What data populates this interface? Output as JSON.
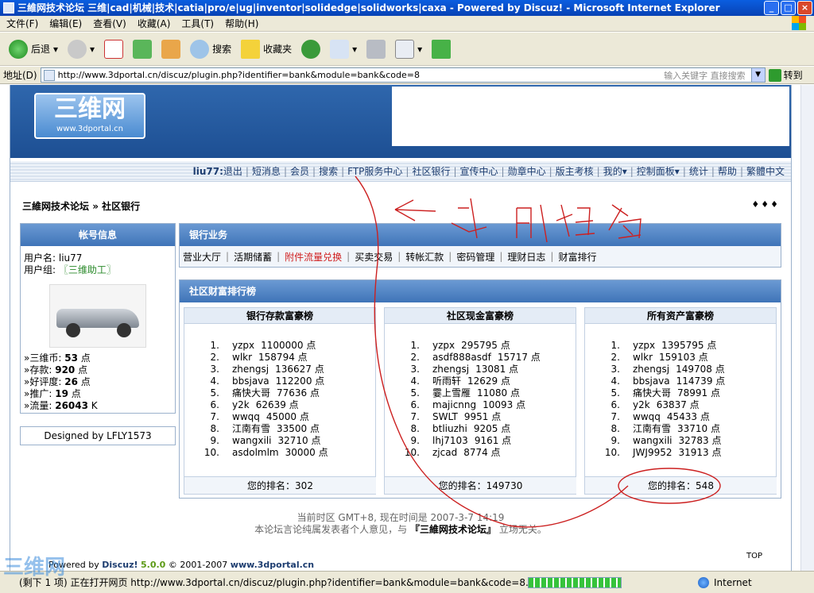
{
  "window": {
    "title": "三維网技术论坛 三维|cad|机械|技术|catia|pro/e|ug|inventor|solidedge|solidworks|caxa - Powered by Discuz! - Microsoft Internet Explorer",
    "controls": [
      "_",
      "□",
      "×"
    ]
  },
  "menu": [
    "文件(F)",
    "编辑(E)",
    "查看(V)",
    "收藏(A)",
    "工具(T)",
    "帮助(H)"
  ],
  "toolbar": {
    "back": "后退",
    "search": "搜索",
    "favorites": "收藏夹"
  },
  "address": {
    "label": "地址(D)",
    "url": "http://www.3dportal.cn/discuz/plugin.php?identifier=bank&module=bank&code=8",
    "hint": "输入关键字 直接搜索",
    "go": "转到"
  },
  "logo": {
    "big": "三维网",
    "small": "www.3dportal.cn"
  },
  "nav": {
    "user": "liu77:",
    "items": [
      "退出",
      "短消息",
      "会员",
      "搜索",
      "FTP服务中心",
      "社区银行",
      "宣传中心",
      "勋章中心",
      "版主考核",
      "我的▾",
      "控制面板▾",
      "统计",
      "帮助",
      "繁體中文"
    ]
  },
  "breadcrumb": {
    "forum": "三維网技术论坛",
    "sep": "»",
    "page": "社区银行"
  },
  "more": "♦♦♦",
  "account": {
    "title": "帐号信息",
    "username_label": "用户名:",
    "username": "liu77",
    "group_label": "用户组:",
    "group": "〖三维助工〗",
    "stats": [
      {
        "label": "»三维币:",
        "value": "53",
        "unit": "点"
      },
      {
        "label": "»存款:",
        "value": "920",
        "unit": "点"
      },
      {
        "label": "»好评度:",
        "value": "26",
        "unit": "点"
      },
      {
        "label": "»推广:",
        "value": "19",
        "unit": "点"
      },
      {
        "label": "»流量:",
        "value": "26043",
        "unit": "K"
      }
    ]
  },
  "designed_by": "Designed by LFLY1573",
  "bank": {
    "title": "银行业务",
    "links": [
      "营业大厅",
      "活期储蓄",
      "附件流量兑换",
      "买卖交易",
      "转帐汇款",
      "密码管理",
      "理财日志",
      "财富排行"
    ]
  },
  "ranking": {
    "title": "社区财富排行榜",
    "columns": [
      {
        "title": "银行存款富豪榜",
        "rows": [
          {
            "n": "1.",
            "name": "yzpx",
            "value": "1100000 点"
          },
          {
            "n": "2.",
            "name": "wlkr",
            "value": "158794 点"
          },
          {
            "n": "3.",
            "name": "zhengsj",
            "value": "136627 点"
          },
          {
            "n": "4.",
            "name": "bbsjava",
            "value": "112200 点"
          },
          {
            "n": "5.",
            "name": "痛快大哥",
            "value": "77636 点"
          },
          {
            "n": "6.",
            "name": "y2k",
            "value": "62639 点"
          },
          {
            "n": "7.",
            "name": "wwqq",
            "value": "45000 点"
          },
          {
            "n": "8.",
            "name": "江南有雪",
            "value": "33500 点"
          },
          {
            "n": "9.",
            "name": "wangxili",
            "value": "32710 点"
          },
          {
            "n": "10.",
            "name": "asdolmlm",
            "value": "30000 点"
          }
        ],
        "rank_label": "您的排名：",
        "rank": "302"
      },
      {
        "title": "社区现金富豪榜",
        "rows": [
          {
            "n": "1.",
            "name": "yzpx",
            "value": "295795 点"
          },
          {
            "n": "2.",
            "name": "asdf888asdf",
            "value": "15717 点"
          },
          {
            "n": "3.",
            "name": "zhengsj",
            "value": "13081 点"
          },
          {
            "n": "4.",
            "name": "听雨轩",
            "value": "12629 点"
          },
          {
            "n": "5.",
            "name": "霎上雪雁",
            "value": "11080 点"
          },
          {
            "n": "6.",
            "name": "majicnng",
            "value": "10093 点"
          },
          {
            "n": "7.",
            "name": "SWLT",
            "value": "9951 点"
          },
          {
            "n": "8.",
            "name": "btliuzhi",
            "value": "9205 点"
          },
          {
            "n": "9.",
            "name": "lhj7103",
            "value": "9161 点"
          },
          {
            "n": "10.",
            "name": "zjcad",
            "value": "8774 点"
          }
        ],
        "rank_label": "您的排名：",
        "rank": "149730"
      },
      {
        "title": "所有资产富豪榜",
        "rows": [
          {
            "n": "1.",
            "name": "yzpx",
            "value": "1395795 点"
          },
          {
            "n": "2.",
            "name": "wlkr",
            "value": "159103 点"
          },
          {
            "n": "3.",
            "name": "zhengsj",
            "value": "149708 点"
          },
          {
            "n": "4.",
            "name": "bbsjava",
            "value": "114739 点"
          },
          {
            "n": "5.",
            "name": "痛快大哥",
            "value": "78991 点"
          },
          {
            "n": "6.",
            "name": "y2k",
            "value": "63837 点"
          },
          {
            "n": "7.",
            "name": "wwqq",
            "value": "45433 点"
          },
          {
            "n": "8.",
            "name": "江南有雪",
            "value": "33710 点"
          },
          {
            "n": "9.",
            "name": "wangxili",
            "value": "32783 点"
          },
          {
            "n": "10.",
            "name": "JWJ9952",
            "value": "31913 点"
          }
        ],
        "rank_label": "您的排名：",
        "rank": "548"
      }
    ]
  },
  "footer": {
    "time": "当前时区 GMT+8, 现在时间是 2007-3-7 14:19",
    "disclaimer_pre": "本论坛言论纯属发表者个人意见，与",
    "disclaimer_name": "『三維网技术论坛』",
    "disclaimer_post": "立场无关。",
    "top": "TOP",
    "powered_pre": "Powered by",
    "discuz": "Discuz!",
    "version": "5.0.0",
    "copyright": "© 2001-2007",
    "site": "www.3dportal.cn"
  },
  "annotation": {
    "text": "我的排名",
    "color": "#cc2020"
  },
  "status": {
    "message": "(剩下 1 项) 正在打开网页 http://www.3dportal.cn/discuz/plugin.php?identifier=bank&module=bank&code=8...",
    "zone": "Internet"
  },
  "watermark": "三维网"
}
